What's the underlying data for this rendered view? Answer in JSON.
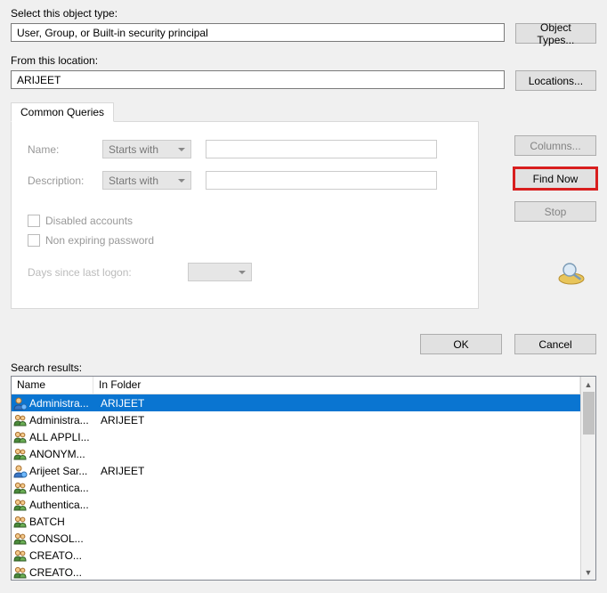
{
  "select_label": "Select this object type:",
  "object_type_value": "User, Group, or Built-in security principal",
  "object_types_btn": "Object Types...",
  "from_location_label": "From this location:",
  "location_value": "ARIJEET",
  "locations_btn": "Locations...",
  "tab_label": "Common Queries",
  "query": {
    "name_label": "Name:",
    "name_mode": "Starts with",
    "desc_label": "Description:",
    "desc_mode": "Starts with",
    "disabled_chk": "Disabled accounts",
    "nonexp_chk": "Non expiring password",
    "days_label": "Days since last logon:"
  },
  "side": {
    "columns": "Columns...",
    "findnow": "Find Now",
    "stop": "Stop"
  },
  "bottom": {
    "ok": "OK",
    "cancel": "Cancel"
  },
  "results_label": "Search results:",
  "columns": {
    "name": "Name",
    "folder": "In Folder"
  },
  "results": [
    {
      "name": "Administra...",
      "folder": "ARIJEET",
      "icon": "user",
      "selected": true
    },
    {
      "name": "Administra...",
      "folder": "ARIJEET",
      "icon": "group",
      "selected": false
    },
    {
      "name": "ALL APPLI...",
      "folder": "",
      "icon": "group",
      "selected": false
    },
    {
      "name": "ANONYM...",
      "folder": "",
      "icon": "group",
      "selected": false
    },
    {
      "name": "Arijeet Sar...",
      "folder": "ARIJEET",
      "icon": "user",
      "selected": false
    },
    {
      "name": "Authentica...",
      "folder": "",
      "icon": "group",
      "selected": false
    },
    {
      "name": "Authentica...",
      "folder": "",
      "icon": "group",
      "selected": false
    },
    {
      "name": "BATCH",
      "folder": "",
      "icon": "group",
      "selected": false
    },
    {
      "name": "CONSOL...",
      "folder": "",
      "icon": "group",
      "selected": false
    },
    {
      "name": "CREATO...",
      "folder": "",
      "icon": "group",
      "selected": false
    },
    {
      "name": "CREATO...",
      "folder": "",
      "icon": "group",
      "selected": false
    }
  ]
}
